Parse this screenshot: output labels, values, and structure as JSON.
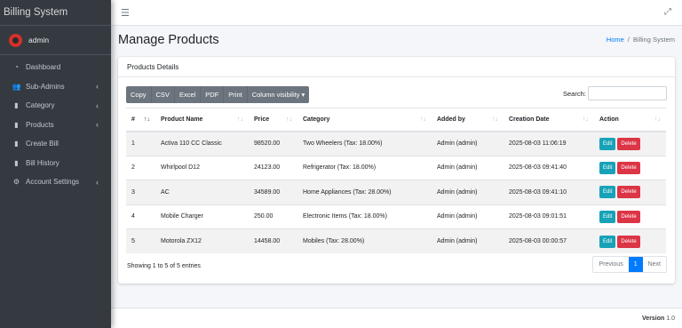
{
  "brand": "Billing System",
  "user": {
    "name": "admin"
  },
  "sidebar": {
    "items": [
      {
        "label": "Dashboard",
        "icon": "tachometer-icon",
        "glyph": "◔",
        "chevron": false
      },
      {
        "label": "Sub-Admins",
        "icon": "users-icon",
        "glyph": "👥",
        "chevron": true
      },
      {
        "label": "Category",
        "icon": "file-icon",
        "glyph": "▮",
        "chevron": true
      },
      {
        "label": "Products",
        "icon": "file-icon",
        "glyph": "▮",
        "chevron": true
      },
      {
        "label": "Create Bill",
        "icon": "file-icon",
        "glyph": "▮",
        "chevron": false
      },
      {
        "label": "Bill History",
        "icon": "file-icon",
        "glyph": "▮",
        "chevron": false
      },
      {
        "label": "Account Settings",
        "icon": "user-cog-icon",
        "glyph": "⚙",
        "chevron": true
      }
    ]
  },
  "header": {
    "title": "Manage Products"
  },
  "breadcrumb": {
    "home": "Home",
    "current": "Billing System"
  },
  "card": {
    "title": "Products Details"
  },
  "toolbar": {
    "buttons": [
      "Copy",
      "CSV",
      "Excel",
      "PDF",
      "Print",
      "Column visibility ▾"
    ]
  },
  "search": {
    "label": "Search:",
    "value": ""
  },
  "table": {
    "columns": [
      "#",
      "Product Name",
      "Price",
      "Category",
      "Added by",
      "Creation Date",
      "Action"
    ],
    "rows": [
      [
        "1",
        "Activa 110 CC Classic",
        "98520.00",
        "Two Wheelers (Tax: 18.00%)",
        "Admin (admin)",
        "2025-08-03 11:06:19"
      ],
      [
        "2",
        "Whirlpool D12",
        "24123.00",
        "Refrigerator (Tax: 18.00%)",
        "Admin (admin)",
        "2025-08-03 09:41:40"
      ],
      [
        "3",
        "AC",
        "34589.00",
        "Home Appliances (Tax: 28.00%)",
        "Admin (admin)",
        "2025-08-03 09:41:10"
      ],
      [
        "4",
        "Mobile Charger",
        "250.00",
        "Electronic Items (Tax: 18.00%)",
        "Admin (admin)",
        "2025-08-03 09:01:51"
      ],
      [
        "5",
        "Motorola ZX12",
        "14458.00",
        "Mobiles (Tax: 28.00%)",
        "Admin (admin)",
        "2025-08-03 00:00:57"
      ]
    ],
    "edit_label": "Edit",
    "delete_label": "Delete"
  },
  "info": "Showing 1 to 5 of 5 entries",
  "pager": {
    "prev": "Previous",
    "page": "1",
    "next": "Next"
  },
  "footer": {
    "version_label": "Version",
    "version": "1.0"
  },
  "colors": {
    "sidebar": "#343a40",
    "primary": "#007bff",
    "info": "#17a2b8",
    "danger": "#dc3545",
    "secondary": "#6c757d"
  }
}
